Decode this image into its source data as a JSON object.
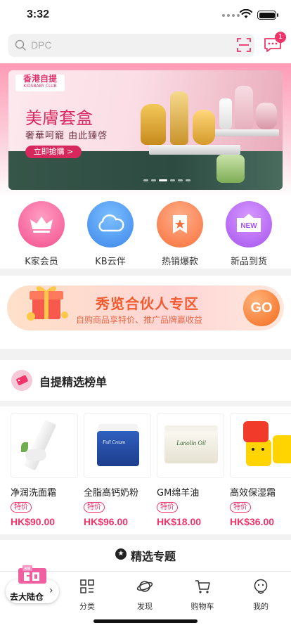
{
  "status": {
    "time": "3:32"
  },
  "search": {
    "placeholder": "DPC",
    "message_count": "1"
  },
  "banner": {
    "logo_main": "香港自提",
    "logo_sub": "KIDSBABY CLUB",
    "title": "美膚套盒",
    "subtitle": "奢華呵寵 由此臻啓",
    "cta": "立即搶購 >"
  },
  "categories": [
    {
      "label": "K家会员",
      "icon": "crown-icon",
      "color": "#f96a9e"
    },
    {
      "label": "KB云伴",
      "icon": "cloud-icon",
      "color": "#4a9bf0"
    },
    {
      "label": "热销爆款",
      "icon": "hot-star-icon",
      "color": "#fb8a5a"
    },
    {
      "label": "新品到货",
      "icon": "new-tag-icon",
      "color": "#b76af0"
    }
  ],
  "promo": {
    "title": "秀览合伙人专区",
    "subtitle": "自购商品享特价、推广品牌赢收益",
    "go": "GO"
  },
  "section": {
    "title": "自提精选榜单"
  },
  "products": [
    {
      "name": "净润洗面霜",
      "tag": "特价",
      "price": "HK$90.00"
    },
    {
      "name": "全脂高钙奶粉",
      "tag": "特价",
      "price": "HK$96.00"
    },
    {
      "name": "GM绵羊油",
      "tag": "特价",
      "price": "HK$18.00"
    },
    {
      "name": "高效保湿霜",
      "tag": "特价",
      "price": "HK$36.00"
    }
  ],
  "topics": {
    "title": "精选专题"
  },
  "tabbar": {
    "home": {
      "label": "去大陆仓",
      "badge": "KB"
    },
    "items": [
      {
        "label": "分类",
        "icon": "grid-icon"
      },
      {
        "label": "发现",
        "icon": "planet-icon"
      },
      {
        "label": "购物车",
        "icon": "cart-icon"
      },
      {
        "label": "我的",
        "icon": "face-icon"
      }
    ]
  },
  "colors": {
    "accent": "#f0346a",
    "promo": "#f25a30"
  }
}
